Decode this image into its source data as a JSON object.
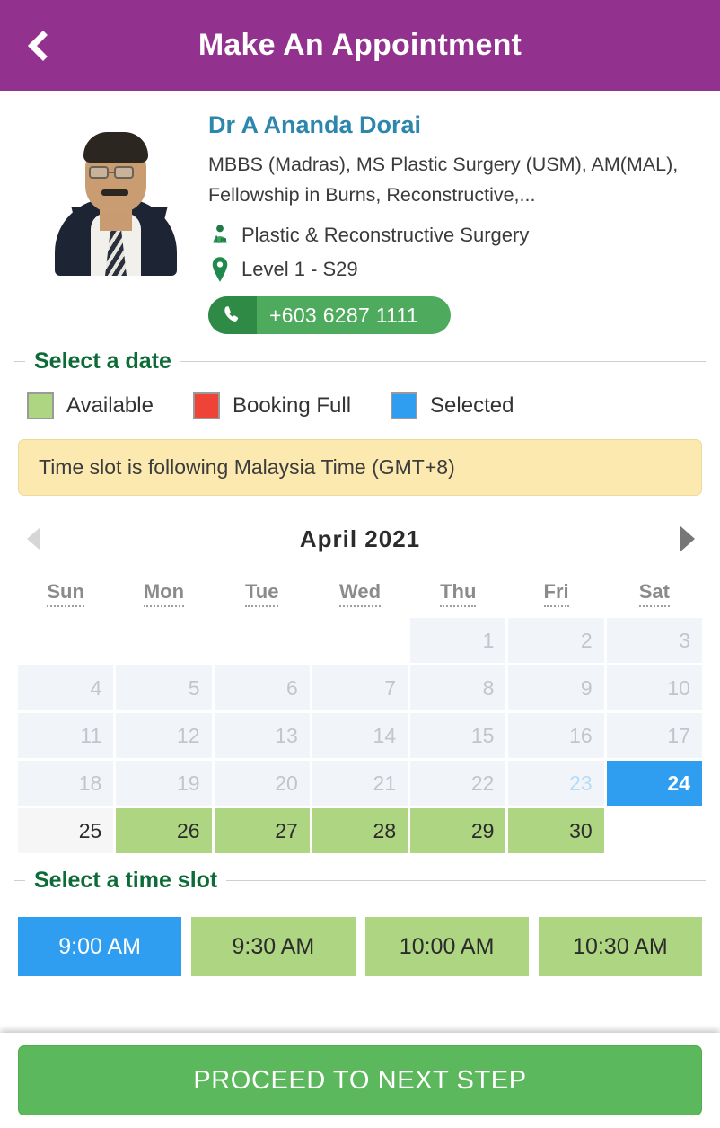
{
  "header": {
    "title": "Make An Appointment",
    "back_icon": "chevron-left-icon",
    "background": "#93328e"
  },
  "doctor": {
    "photo_alt": "doctor-portrait",
    "name": "Dr A Ananda Dorai",
    "qualifications": "MBBS (Madras), MS Plastic Surgery (USM), AM(MAL), Fellowship in Burns, Reconstructive,...",
    "specialty_icon": "doctor-icon",
    "specialty": "Plastic & Reconstructive Surgery",
    "location_icon": "location-pin-icon",
    "location": "Level 1 - S29",
    "phone_icon": "phone-icon",
    "phone": "+603 6287 1111",
    "name_color": "#2c86ad",
    "phone_button_color": "#4eaa5c"
  },
  "date_section": {
    "label": "Select a date",
    "legend": [
      {
        "label": "Available",
        "color": "#aed581"
      },
      {
        "label": "Booking Full",
        "color": "#f04337"
      },
      {
        "label": "Selected",
        "color": "#2f9ef0"
      }
    ],
    "notice": "Time slot is following Malaysia Time (GMT+8)"
  },
  "calendar": {
    "prev_icon": "triangle-left-icon",
    "next_icon": "triangle-right-icon",
    "month": "April",
    "year": "2021",
    "title": "April  2021",
    "weekdays": [
      "Sun",
      "Mon",
      "Tue",
      "Wed",
      "Thu",
      "Fri",
      "Sat"
    ],
    "weeks": [
      [
        {
          "day": "",
          "state": "empty"
        },
        {
          "day": "",
          "state": "empty"
        },
        {
          "day": "",
          "state": "empty"
        },
        {
          "day": "",
          "state": "empty"
        },
        {
          "day": "1",
          "state": "past"
        },
        {
          "day": "2",
          "state": "past"
        },
        {
          "day": "3",
          "state": "past"
        }
      ],
      [
        {
          "day": "4",
          "state": "past"
        },
        {
          "day": "5",
          "state": "past"
        },
        {
          "day": "6",
          "state": "past"
        },
        {
          "day": "7",
          "state": "past"
        },
        {
          "day": "8",
          "state": "past"
        },
        {
          "day": "9",
          "state": "past"
        },
        {
          "day": "10",
          "state": "past"
        }
      ],
      [
        {
          "day": "11",
          "state": "past"
        },
        {
          "day": "12",
          "state": "past"
        },
        {
          "day": "13",
          "state": "past"
        },
        {
          "day": "14",
          "state": "past"
        },
        {
          "day": "15",
          "state": "past"
        },
        {
          "day": "16",
          "state": "past"
        },
        {
          "day": "17",
          "state": "past"
        }
      ],
      [
        {
          "day": "18",
          "state": "past"
        },
        {
          "day": "19",
          "state": "past"
        },
        {
          "day": "20",
          "state": "past"
        },
        {
          "day": "21",
          "state": "past"
        },
        {
          "day": "22",
          "state": "past"
        },
        {
          "day": "23",
          "state": "today"
        },
        {
          "day": "24",
          "state": "selected"
        }
      ],
      [
        {
          "day": "25",
          "state": "disabled"
        },
        {
          "day": "26",
          "state": "available"
        },
        {
          "day": "27",
          "state": "available"
        },
        {
          "day": "28",
          "state": "available"
        },
        {
          "day": "29",
          "state": "available"
        },
        {
          "day": "30",
          "state": "available"
        },
        {
          "day": "",
          "state": "empty"
        }
      ]
    ]
  },
  "time_section": {
    "label": "Select a time slot",
    "slots": [
      {
        "label": "9:00 AM",
        "state": "selected"
      },
      {
        "label": "9:30 AM",
        "state": "available"
      },
      {
        "label": "10:00 AM",
        "state": "available"
      },
      {
        "label": "10:30 AM",
        "state": "available"
      }
    ]
  },
  "cta": {
    "label": "PROCEED TO NEXT STEP",
    "color": "#5cb85c"
  }
}
